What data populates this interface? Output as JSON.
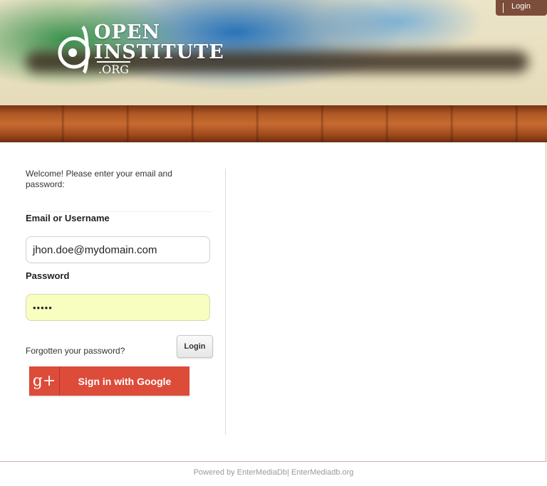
{
  "header": {
    "logo": {
      "line1": "OPEN",
      "line2": "INSTITUTE",
      "line3": ".ORG"
    },
    "top_login_label": "Login"
  },
  "login": {
    "welcome_text": "Welcome! Please enter your email and password:",
    "email_label": "Email or Username",
    "email_value": "jhon.doe@mydomain.com",
    "password_label": "Password",
    "password_value": "•••••",
    "forgot_link": "Forgotten your password?",
    "login_button": "Login",
    "google_button": "Sign in with Google",
    "google_icon": "g+"
  },
  "footer": {
    "text": "Powered by EnterMediaDb| EnterMediadb.org"
  },
  "colors": {
    "google_red": "#dd4b39",
    "topbar_brown": "#7c4d3a",
    "password_fill": "#f8fdc0"
  }
}
